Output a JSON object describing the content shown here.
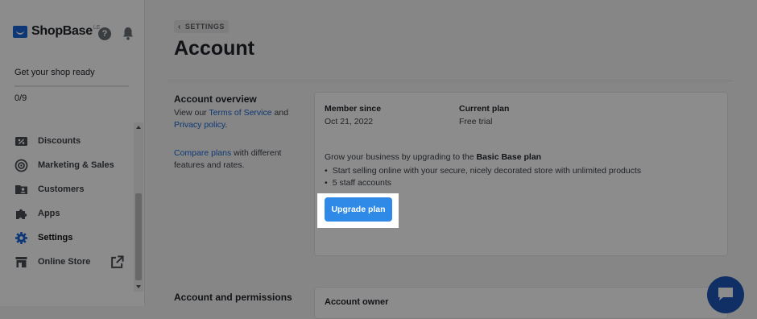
{
  "brand": {
    "name": "ShopBase",
    "sup": "LE"
  },
  "sidebar": {
    "ready_text": "Get your shop ready",
    "progress_text": "0/9",
    "progress_fraction": 0,
    "items": [
      {
        "label": "Discounts",
        "icon": "discount-icon"
      },
      {
        "label": "Marketing & Sales",
        "icon": "target-icon"
      },
      {
        "label": "Customers",
        "icon": "customers-icon"
      },
      {
        "label": "Apps",
        "icon": "puzzle-icon"
      },
      {
        "label": "Settings",
        "icon": "gear-icon",
        "active": true
      },
      {
        "label": "Online Store",
        "icon": "store-icon"
      }
    ]
  },
  "main": {
    "breadcrumb": "SETTINGS",
    "title": "Account",
    "overview": {
      "title": "Account overview",
      "view_our": "View our",
      "tos_link": "Terms of Service",
      "and": "and",
      "privacy_link": "Privacy policy",
      "period": ".",
      "compare_link": "Compare plans",
      "compare_rest": "with different features and rates."
    },
    "card": {
      "member_since_label": "Member since",
      "member_since_value": "Oct 21, 2022",
      "current_plan_label": "Current plan",
      "current_plan_value": "Free trial",
      "grow_text": "Grow your business by upgrading to the",
      "plan_name": "Basic Base plan",
      "bullets": [
        "Start selling online with your secure, nicely decorated store with unlimited products",
        "5 staff accounts"
      ],
      "upgrade_label": "Upgrade plan"
    },
    "permissions": {
      "title": "Account and permissions",
      "owner_label": "Account owner"
    }
  },
  "colors": {
    "accent": "#2e8ae6",
    "brand": "#1a66d6",
    "chat": "#1e58b8"
  }
}
